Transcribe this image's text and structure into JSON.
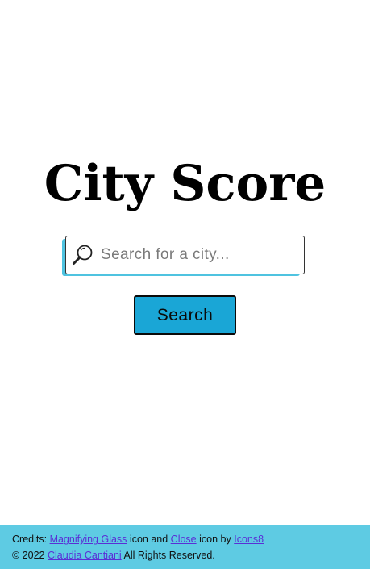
{
  "header": {
    "title": "City Score"
  },
  "search": {
    "placeholder": "Search for a city...",
    "value": "",
    "button_label": "Search",
    "icon": "magnifying-glass-icon"
  },
  "footer": {
    "credits_prefix": "Credits:",
    "link_magnifying_glass": "Magnifying Glass",
    "icon_and": "icon and",
    "link_close": "Close",
    "icon_by": "icon by",
    "link_icons8": "Icons8",
    "copyright_prefix": "© 2022",
    "link_author": "Claudia Cantiani",
    "rights": "All Rights Reserved."
  },
  "colors": {
    "accent": "#1aa6d6",
    "shadow": "#4fc3e0",
    "footer_bg": "#5ecbe3",
    "link": "#5a2fd6"
  }
}
